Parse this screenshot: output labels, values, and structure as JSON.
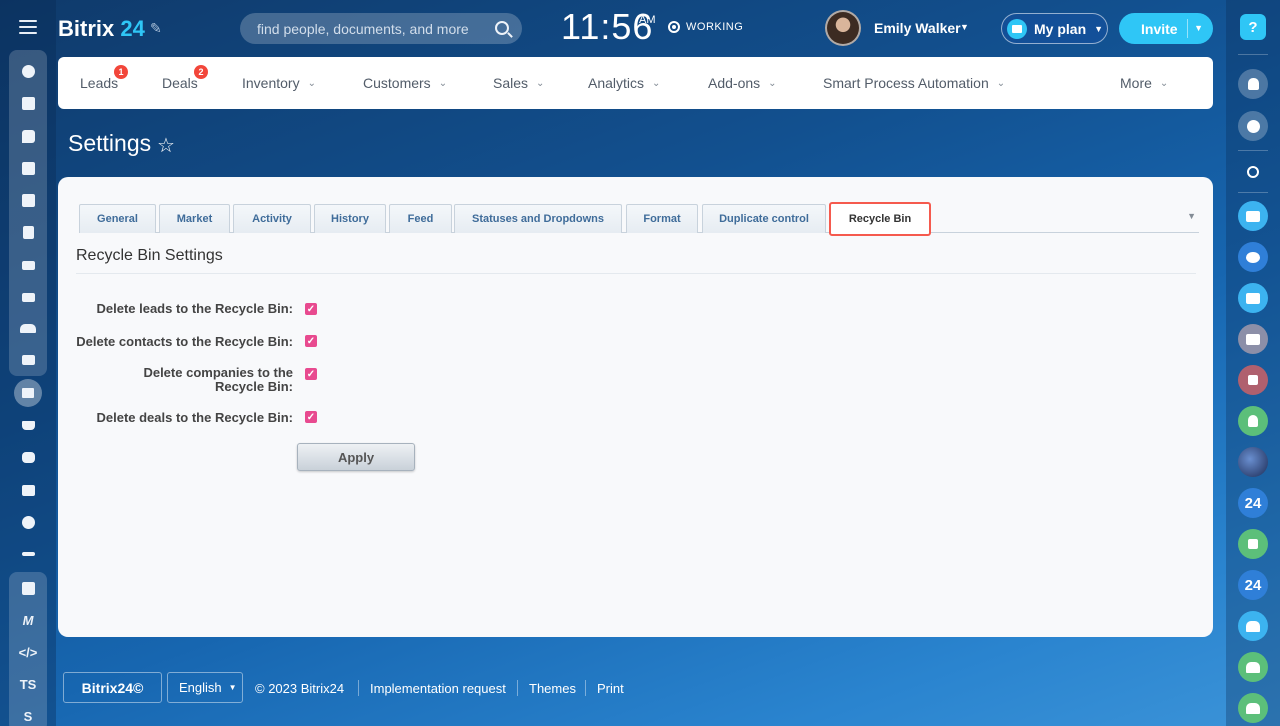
{
  "app": {
    "logo_text": "Bitrix",
    "logo_num": "24",
    "search_placeholder": "find people, documents, and more",
    "clock": "11:56",
    "clock_ampm": "AM",
    "work_status": "WORKING",
    "user_name": "Emily Walker",
    "my_plan_label": "My plan",
    "invite_label": "Invite"
  },
  "topnav": {
    "items": [
      {
        "label": "Leads",
        "badge": "1"
      },
      {
        "label": "Deals",
        "badge": "2"
      },
      {
        "label": "Inventory"
      },
      {
        "label": "Customers"
      },
      {
        "label": "Sales"
      },
      {
        "label": "Analytics"
      },
      {
        "label": "Add-ons"
      },
      {
        "label": "Smart Process Automation"
      },
      {
        "label": "More"
      }
    ]
  },
  "page": {
    "title": "Settings"
  },
  "tabs": [
    {
      "label": "General"
    },
    {
      "label": "Market"
    },
    {
      "label": "Activity"
    },
    {
      "label": "History"
    },
    {
      "label": "Feed"
    },
    {
      "label": "Statuses and Dropdowns"
    },
    {
      "label": "Format"
    },
    {
      "label": "Duplicate control"
    },
    {
      "label": "Recycle Bin",
      "active": true
    }
  ],
  "recycle_bin": {
    "section_title": "Recycle Bin Settings",
    "options": [
      {
        "label": "Delete leads to the Recycle Bin:",
        "checked": true
      },
      {
        "label": "Delete contacts to the Recycle Bin:",
        "checked": true
      },
      {
        "label": "Delete companies to the Recycle Bin:",
        "checked": true
      },
      {
        "label": "Delete deals to the Recycle Bin:",
        "checked": true
      }
    ],
    "apply_label": "Apply"
  },
  "left_sidebar": {
    "text_items": [
      "TS",
      "S"
    ]
  },
  "right_sidebar": {
    "help_label": "?",
    "badge_24": "24"
  },
  "footer": {
    "logo": "Bitrix24©",
    "language": "English",
    "copyright": "© 2023 Bitrix24",
    "implementation": "Implementation request",
    "themes": "Themes",
    "print": "Print"
  },
  "colors": {
    "accent": "#2fc6f6",
    "checkbox": "#e84a8f",
    "badge": "#f2463a",
    "active_tab_border": "#f55a4e"
  }
}
